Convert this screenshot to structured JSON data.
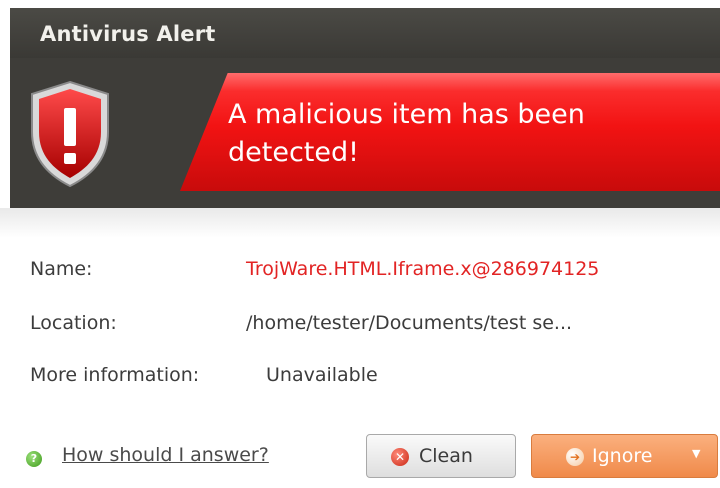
{
  "window": {
    "title": "Antivirus Alert"
  },
  "banner": {
    "headline_line1": "A malicious item has been",
    "headline_line2": "detected!"
  },
  "details": {
    "name_label": "Name:",
    "name_value": "TrojWare.HTML.Iframe.x@286974125",
    "location_label": "Location:",
    "location_value": "/home/tester/Documents/test  se...",
    "more_label": "More information:",
    "more_value": "Unavailable"
  },
  "footer": {
    "help_link": "How should I answer?",
    "clean_label": "Clean",
    "ignore_label": "Ignore"
  },
  "colors": {
    "alert_red": "#e22424",
    "banner_red": "#f21313",
    "ignore_orange": "#f08a4a",
    "titlebar": "#3e3d39"
  },
  "icons": {
    "shield": "shield-warning-icon",
    "help": "help-icon",
    "clean": "clean-icon",
    "ignore": "ignore-icon",
    "dropdown": "chevron-down-icon"
  }
}
